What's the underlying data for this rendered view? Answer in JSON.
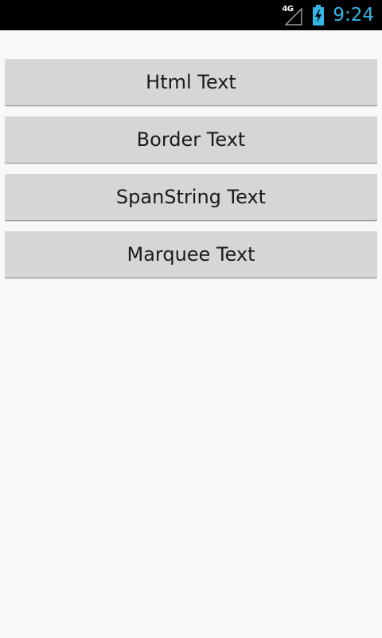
{
  "status_bar": {
    "network_type": "4G",
    "time": "9:24",
    "icons": [
      "signal-icon",
      "battery-charging-icon"
    ],
    "colors": {
      "background": "#000000",
      "time": "#33b5e5",
      "battery": "#33b5e5"
    }
  },
  "main": {
    "buttons": [
      {
        "label": "Html Text"
      },
      {
        "label": "Border Text"
      },
      {
        "label": "SpanString Text"
      },
      {
        "label": "Marquee Text"
      }
    ],
    "colors": {
      "background": "#f8f8f8",
      "button": "#d6d6d6",
      "button_text": "#1a1a1a"
    }
  }
}
